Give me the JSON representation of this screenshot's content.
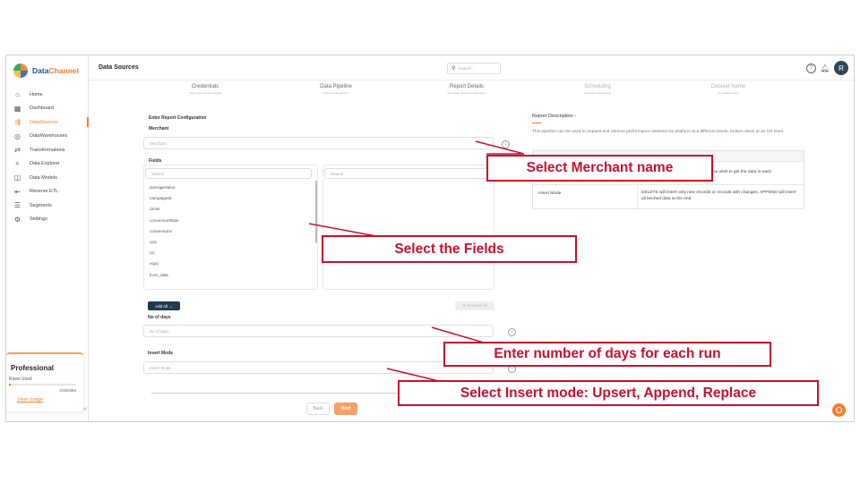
{
  "app": {
    "logo_prefix": "Data",
    "logo_suffix": "Channel",
    "page_title": "Data Sources"
  },
  "sidebar": {
    "items": [
      {
        "label": "Home",
        "icon": "home-icon",
        "glyph": "⌂"
      },
      {
        "label": "Dashboard",
        "icon": "dashboard-icon",
        "glyph": "▦"
      },
      {
        "label": "DataSources",
        "icon": "datasources-icon",
        "glyph": "⇶",
        "active": true
      },
      {
        "label": "DataWarehouses",
        "icon": "warehouse-icon",
        "glyph": "◎"
      },
      {
        "label": "Transformations",
        "icon": "transform-icon",
        "glyph": "⇄"
      },
      {
        "label": "Data Explorer",
        "icon": "explorer-icon",
        "glyph": "⌕"
      },
      {
        "label": "Data Models",
        "icon": "models-icon",
        "glyph": "◫"
      },
      {
        "label": "Reverse ETL",
        "icon": "reverse-etl-icon",
        "glyph": "⇤"
      },
      {
        "label": "Segments",
        "icon": "segments-icon",
        "glyph": "☰"
      },
      {
        "label": "Settings",
        "icon": "settings-icon",
        "glyph": "⚙"
      }
    ],
    "plan": {
      "title": "Professional",
      "rows_label": "Rows Used",
      "rows_count": "0/36/20M",
      "link": "View Usage",
      "usage_fraction": 0.02
    },
    "collapse_glyph": "«"
  },
  "header": {
    "search_placeholder": "Search...",
    "help_glyph": "?",
    "bell_glyph": "♫",
    "avatar_initial": "R"
  },
  "steps": [
    {
      "title": "Credentials",
      "subtitle": "Select your account details",
      "dim": false
    },
    {
      "title": "Data Pipeline",
      "subtitle": "Select a data pipeline",
      "dim": false
    },
    {
      "title": "Report Details",
      "subtitle": "Enter data pipeline configuration",
      "dim": false
    },
    {
      "title": "Scheduling",
      "subtitle": "Schedule data pipeline",
      "dim": true
    },
    {
      "title": "Dataset Name",
      "subtitle": "Set dataset name",
      "dim": true
    }
  ],
  "form": {
    "section_title": "Enter Report Configuration",
    "merchant_label": "Merchant",
    "merchant_placeholder": "Merchant",
    "fields_label": "Fields",
    "fields_search_placeholder": "Search",
    "selected_search_placeholder": "Search",
    "fields": [
      "averageValue",
      "campaignId",
      "clicks",
      "conversionRate",
      "conversions",
      "cpa",
      "ctr",
      "ecpc",
      "from_date"
    ],
    "add_all": "Add All →",
    "remove_all": "✕ Remove All",
    "days_label": "No of days",
    "days_placeholder": "No of days",
    "insert_label": "Insert Mode",
    "insert_placeholder": "Insert Mode",
    "back": "Back",
    "next": "Next",
    "info_glyph": "i"
  },
  "description": {
    "title": "Report Description -",
    "text": "This pipeline can be used to request and retrieve performance statistics by platform at a different levels, broken down at an OS level.",
    "row1_value": "ou wish to get the data in each",
    "row2_key": "Insert Mode",
    "row2_value": "DELETE will insert only new records or records with changes, APPEND will insert all fetched data at the end."
  },
  "callouts": {
    "merchant": "Select Merchant name",
    "fields": "Select the Fields",
    "days": "Enter number of days for each run",
    "insert": "Select Insert mode: Upsert, Append, Replace"
  },
  "colors": {
    "accent": "#f27c2c",
    "callout": "#c8102e",
    "navy": "#233a4e"
  }
}
